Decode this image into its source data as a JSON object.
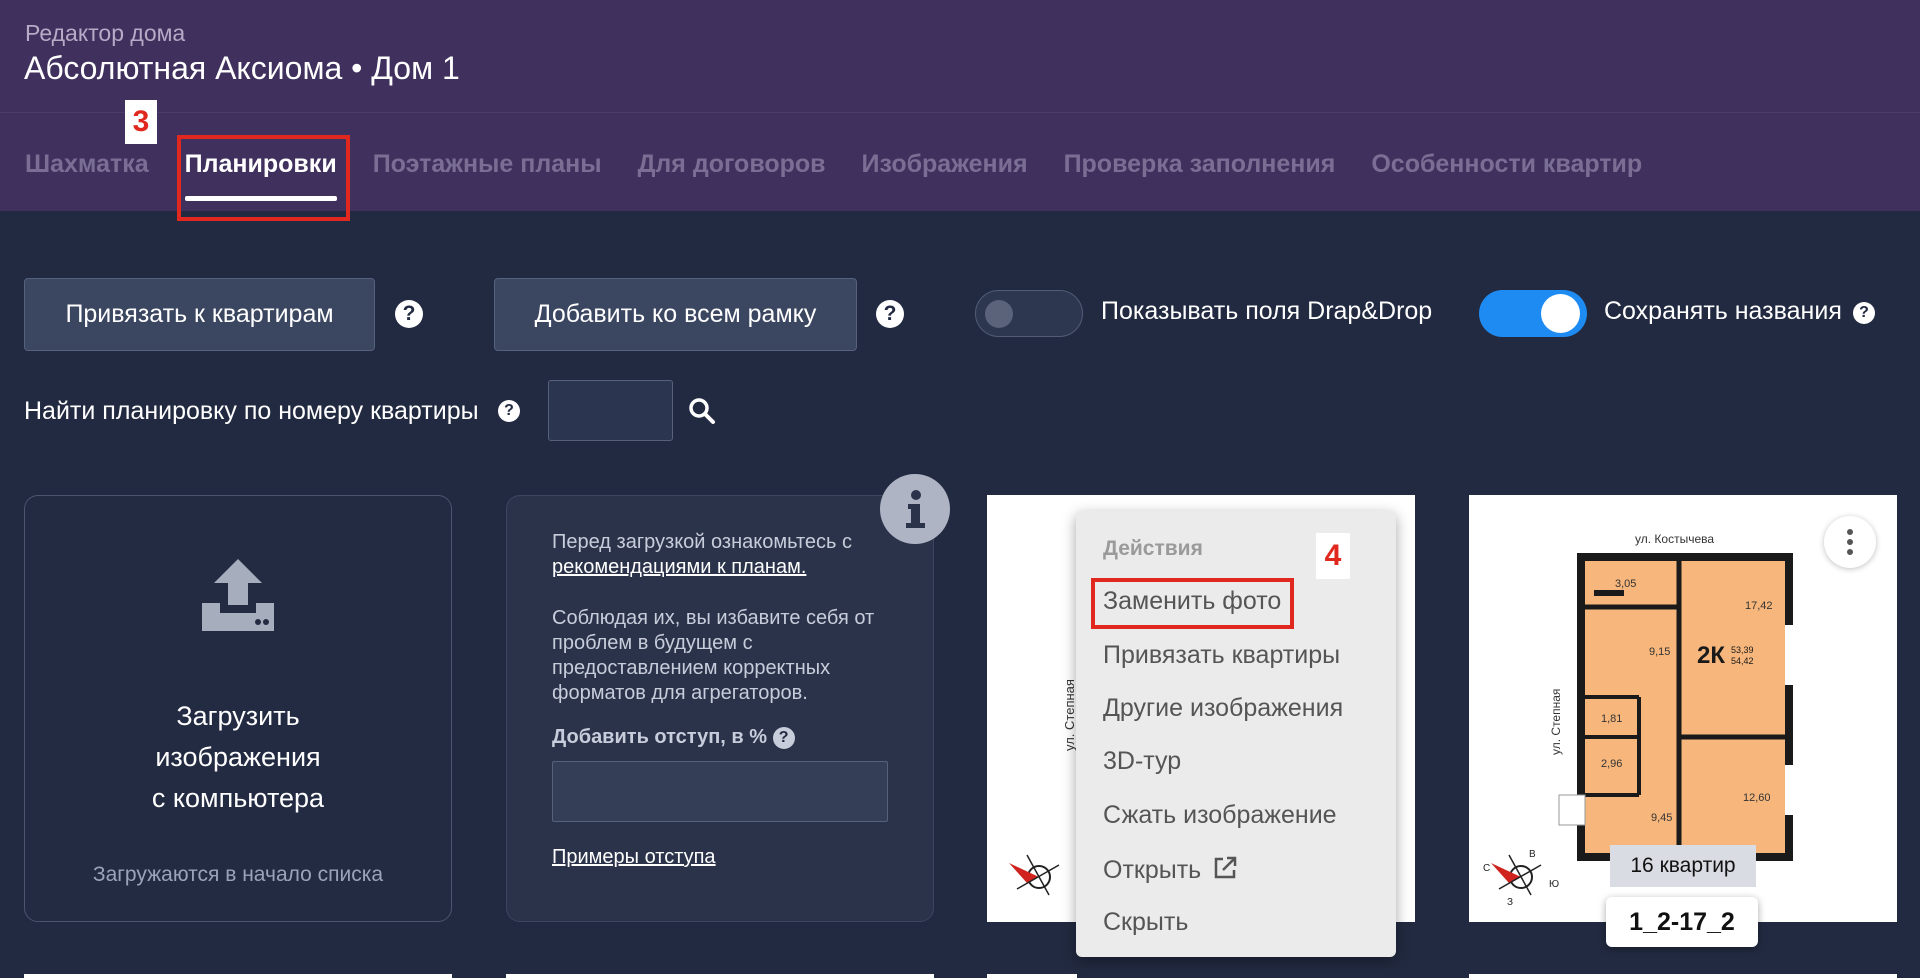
{
  "header": {
    "subtitle": "Редактор дома",
    "title": "Абсолютная Аксиома • Дом 1"
  },
  "tabs": [
    {
      "label": "Шахматка",
      "active": false
    },
    {
      "label": "Планировки",
      "active": true
    },
    {
      "label": "Поэтажные планы",
      "active": false
    },
    {
      "label": "Для договоров",
      "active": false
    },
    {
      "label": "Изображения",
      "active": false
    },
    {
      "label": "Проверка заполнения",
      "active": false
    },
    {
      "label": "Особенности квартир",
      "active": false
    }
  ],
  "annotations": {
    "tab_step": "3",
    "menu_step": "4"
  },
  "toolbar": {
    "link_apartments_label": "Привязать к квартирам",
    "add_frame_label": "Добавить ко всем рамку",
    "dragdrop_label": "Показывать поля Drap&Drop",
    "dragdrop_on": false,
    "save_names_label": "Сохранять названия",
    "save_names_on": true,
    "help_glyph": "?"
  },
  "search": {
    "label": "Найти планировку по номеру квартиры",
    "value": "",
    "icon": "search-icon"
  },
  "upload_card": {
    "title": "Загрузить\nизображения\nс компьютера",
    "note": "Загружаются в начало списка",
    "icon": "upload-icon"
  },
  "info_card": {
    "text_before": "Перед загрузкой ознакомьтесь с",
    "link": "рекомендациями к планам.",
    "paragraph": "Соблюдая их, вы избавите себя от проблем в будущем с предоставлением корректных форматов для агрегаторов.",
    "indent_label": "Добавить отступ, в %",
    "indent_value": "",
    "examples_link": "Примеры отступа",
    "icon": "info-icon"
  },
  "menu": {
    "header": "Действия",
    "items": [
      "Заменить фото",
      "Привязать квартиры",
      "Другие изображения",
      "3D-тур",
      "Сжать изображение",
      "Открыть",
      "Скрыть"
    ]
  },
  "plan_left": {
    "street": "ул. Степная"
  },
  "plan_right": {
    "street_top": "ул. Костычева",
    "street_side": "ул. Степная",
    "type": "2К",
    "area_1": "53,39",
    "area_2": "54,42",
    "rooms": [
      "3,05",
      "17,42",
      "9,15",
      "1,81",
      "2,96",
      "9,45",
      "12,60"
    ],
    "compass": [
      "С",
      "В",
      "З",
      "Ю"
    ],
    "apartments_count": "16 квартир",
    "plan_name": "1_2-17_2"
  },
  "colors": {
    "header_bg": "#40305d",
    "page_bg": "#222a41",
    "accent_blue": "#1e8bf2",
    "annotation_red": "#e0281e",
    "room_fill": "#f7b67b"
  }
}
